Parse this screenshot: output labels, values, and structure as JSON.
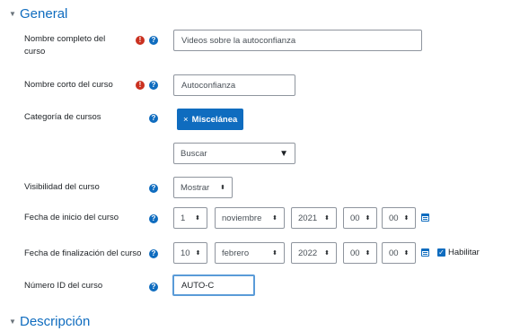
{
  "general_section": {
    "title": "General",
    "toggle_icon": "chevron-down"
  },
  "fields": {
    "fullname": {
      "label": "Nombre completo del curso",
      "value": "Videos sobre la autoconfianza"
    },
    "shortname": {
      "label": "Nombre corto del curso",
      "value": "Autoconfianza"
    },
    "category": {
      "label": "Categoría de cursos",
      "selected_tag": "Miscelánea",
      "tag_remove": "×",
      "search_placeholder": "Buscar"
    },
    "visibility": {
      "label": "Visibilidad del curso",
      "value": "Mostrar"
    },
    "startdate": {
      "label": "Fecha de inicio del curso",
      "day": "1",
      "month": "noviembre",
      "year": "2021",
      "hour": "00",
      "minute": "00"
    },
    "enddate": {
      "label": "Fecha de finalización del curso",
      "day": "10",
      "month": "febrero",
      "year": "2022",
      "hour": "00",
      "minute": "00",
      "enable_label": "Habilitar",
      "enabled": true
    },
    "idnumber": {
      "label": "Número ID del curso",
      "value": "AUTO-C"
    }
  },
  "description_section": {
    "title": "Descripción"
  },
  "colors": {
    "link": "#0f6cbf",
    "required": "#ca3120",
    "focus_border": "#5a9bd8"
  }
}
